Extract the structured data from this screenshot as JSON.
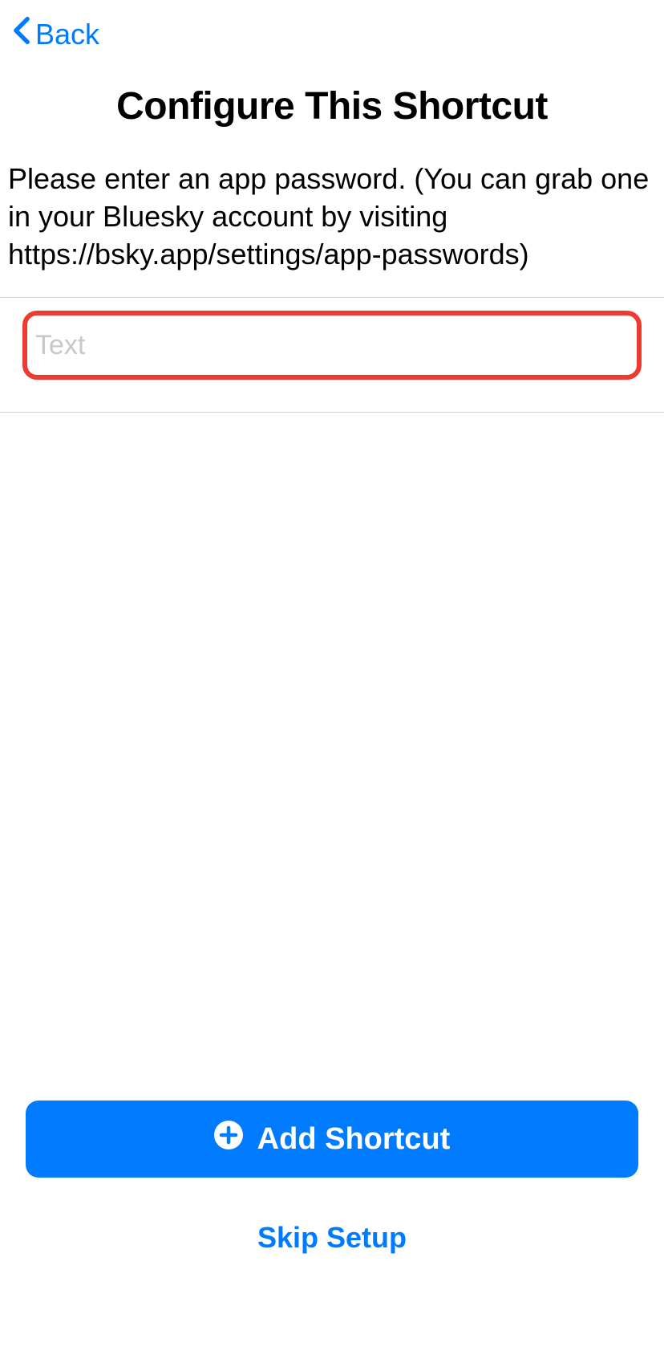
{
  "nav": {
    "back_label": "Back"
  },
  "page": {
    "title": "Configure This Shortcut",
    "description": "Please enter an app password. (You can grab one in your Bluesky account by visiting https://bsky.app/settings/app-passwords)"
  },
  "input": {
    "placeholder": "Text",
    "value": ""
  },
  "actions": {
    "add_label": "Add Shortcut",
    "skip_label": "Skip Setup"
  }
}
